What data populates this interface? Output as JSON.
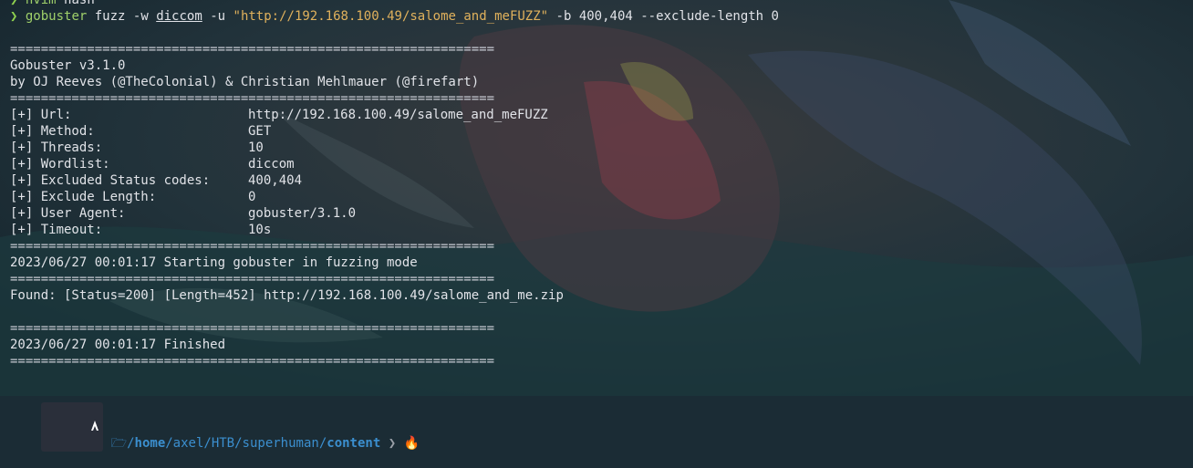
{
  "prev_command": {
    "arrow": "❯",
    "cmd": "nvim",
    "arg": "hash"
  },
  "command": {
    "arrow": "❯",
    "cmd": "gobuster",
    "a1": "fuzz",
    "a2": "-w",
    "wordlist": "diccom",
    "a3": "-u",
    "url": "\"http://192.168.100.49/salome_and_meFUZZ\"",
    "rest": "-b 400,404 --exclude-length 0"
  },
  "separator": "===============================================================",
  "banner": {
    "version": "Gobuster v3.1.0",
    "authors": "by OJ Reeves (@TheColonial) & Christian Mehlmauer (@firefart)"
  },
  "config": [
    {
      "key": "[+] Url:",
      "value": "http://192.168.100.49/salome_and_meFUZZ"
    },
    {
      "key": "[+] Method:",
      "value": "GET"
    },
    {
      "key": "[+] Threads:",
      "value": "10"
    },
    {
      "key": "[+] Wordlist:",
      "value": "diccom"
    },
    {
      "key": "[+] Excluded Status codes:",
      "value": "400,404"
    },
    {
      "key": "[+] Exclude Length:",
      "value": "0"
    },
    {
      "key": "[+] User Agent:",
      "value": "gobuster/3.1.0"
    },
    {
      "key": "[+] Timeout:",
      "value": "10s"
    }
  ],
  "start_msg": "2023/06/27 00:01:17 Starting gobuster in fuzzing mode",
  "found": "Found: [Status=200] [Length=452] http://192.168.100.49/salome_and_me.zip",
  "finish_msg": "2023/06/27 00:01:17 Finished",
  "prompt": {
    "os_icon": "linux-icon",
    "folder_icon": "folder-icon",
    "path_prefix": "/",
    "path_home": "home",
    "path_mid": "/axel/HTB/superhuman/",
    "path_last": "content",
    "status_icon": "fire-icon"
  },
  "colors": {
    "green": "#8fd14f",
    "string": "#e0b15c",
    "path": "#3b8fcf",
    "text": "#e1e3e8"
  }
}
